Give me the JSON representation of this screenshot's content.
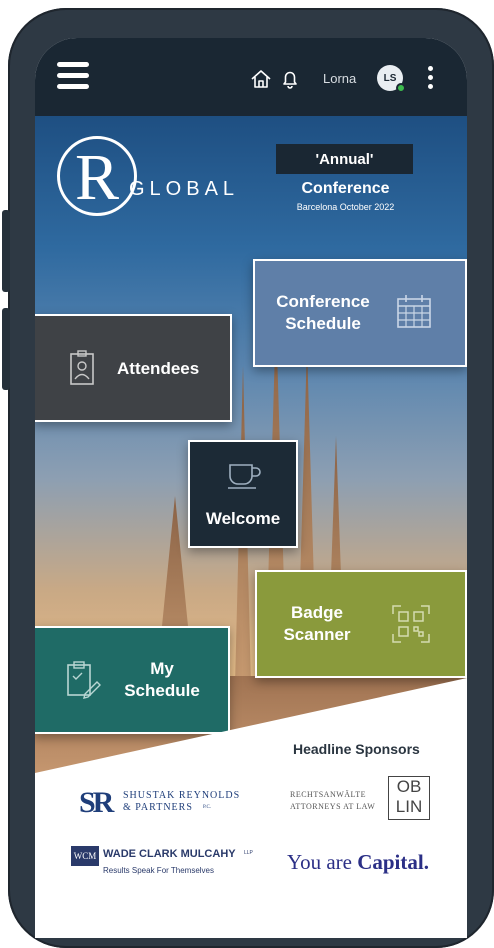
{
  "topbar": {
    "user_name": "Lorna",
    "avatar_initials": "LS"
  },
  "hero": {
    "logo_letter": "R",
    "logo_word": "GLOBAL",
    "badge": "'Annual'",
    "conference_title": "Conference",
    "conference_subtitle": "Barcelona October 2022"
  },
  "tiles": {
    "conference_schedule": {
      "line1": "Conference",
      "line2": "Schedule",
      "color": "#5f7fa8"
    },
    "attendees": {
      "label": "Attendees",
      "color": "#3f4246"
    },
    "welcome": {
      "label": "Welcome",
      "color": "#1c2a36"
    },
    "badge_scanner": {
      "line1": "Badge",
      "line2": "Scanner",
      "color": "#8a9a3c"
    },
    "my_schedule": {
      "line1": "My",
      "line2": "Schedule",
      "color": "#1f6b66"
    }
  },
  "sponsors": {
    "title": "Headline Sponsors",
    "shustak": {
      "mark": "SR",
      "line1": "SHUSTAK REYNOLDS",
      "line2": "& PARTNERS",
      "suffix": "P.C."
    },
    "rechts": {
      "line1": "RECHTSANWÄLTE",
      "line2": "ATTORNEYS AT LAW",
      "mark_top": "OB",
      "mark_bottom": "LIN"
    },
    "wcm": {
      "mark": "WCM",
      "line1": "WADE CLARK MULCAHY",
      "suffix": "LLP",
      "line2": "Results Speak For Themselves"
    },
    "capital": {
      "text_regular": "You are ",
      "text_bold": "Capital."
    }
  }
}
